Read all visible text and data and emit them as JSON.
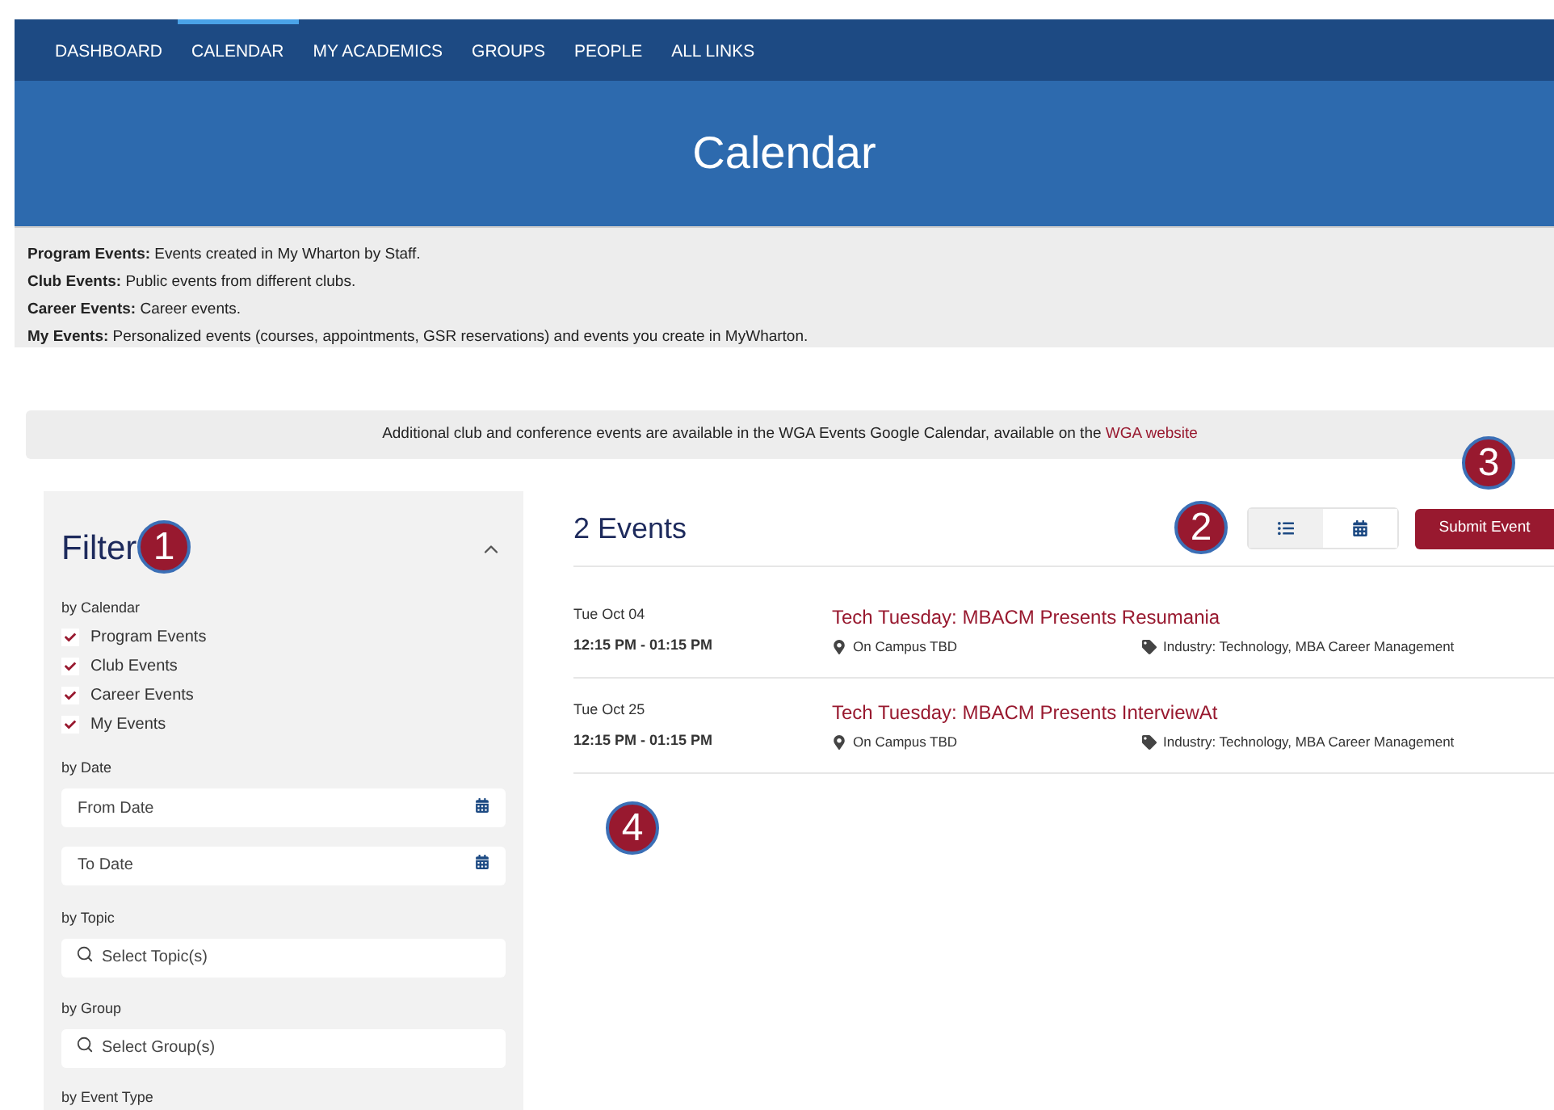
{
  "nav": [
    {
      "label": "DASHBOARD",
      "selected": false
    },
    {
      "label": "CALENDAR",
      "selected": true
    },
    {
      "label": "MY ACADEMICS",
      "selected": false
    },
    {
      "label": "GROUPS",
      "selected": false
    },
    {
      "label": "PEOPLE",
      "selected": false
    },
    {
      "label": "ALL LINKS",
      "selected": false
    }
  ],
  "banner": {
    "title": "Calendar"
  },
  "legend": [
    {
      "term": "Program Events:",
      "text": "Events created in My Wharton by Staff."
    },
    {
      "term": "Club Events:",
      "text": "Public events from different clubs."
    },
    {
      "term": "Career Events:",
      "text": "Career events."
    },
    {
      "term": "My Events:",
      "text": "Personalized events (courses, appointments, GSR reservations) and events you create in MyWharton."
    }
  ],
  "notice": {
    "text": "Additional club and conference events are available in the WGA Events Google Calendar, available on the",
    "link": "WGA website"
  },
  "filter": {
    "title": "Filter",
    "expanded": true,
    "calendar_label": "by Calendar",
    "calendars": [
      {
        "label": "Program Events",
        "checked": true
      },
      {
        "label": "Club Events",
        "checked": true
      },
      {
        "label": "Career Events",
        "checked": true
      },
      {
        "label": "My Events",
        "checked": true
      }
    ],
    "date_label": "by Date",
    "date_fields": [
      {
        "placeholder": "From Date"
      },
      {
        "placeholder": "To Date"
      }
    ],
    "topic_label": "by Topic",
    "topic_placeholder": "Select Topic(s)",
    "group_label": "by Group",
    "group_placeholder": "Select Group(s)",
    "event_type_label": "by Event Type"
  },
  "events": {
    "count": "2 Events",
    "views": [
      {
        "kind": "list",
        "selected": true
      },
      {
        "kind": "calendar",
        "selected": false
      }
    ],
    "submit": "Submit Event",
    "items": [
      {
        "date": "Tue Oct 04",
        "time": "12:15 PM - 01:15 PM",
        "title": "Tech Tuesday: MBACM Presents Resumania",
        "location": "On Campus TBD",
        "tags": "Industry: Technology, MBA Career Management"
      },
      {
        "date": "Tue Oct 25",
        "time": "12:15 PM - 01:15 PM",
        "title": "Tech Tuesday: MBACM Presents InterviewAt",
        "location": "On Campus TBD",
        "tags": "Industry: Technology, MBA Career Management"
      }
    ]
  },
  "callouts": [
    "1",
    "2",
    "3",
    "4"
  ]
}
